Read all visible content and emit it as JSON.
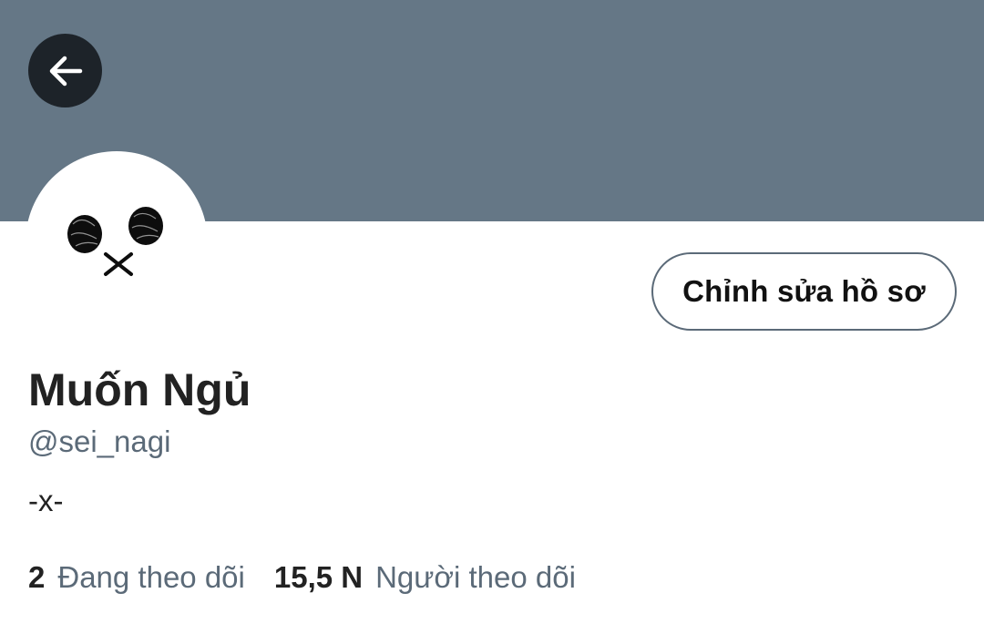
{
  "colors": {
    "banner": "#657786",
    "back_button_bg": "#1d2329",
    "secondary_text": "#5b6a78",
    "primary_text": "#222222"
  },
  "header": {
    "back_icon": "arrow-left-icon"
  },
  "profile": {
    "edit_button_label": "Chỉnh sửa hồ sơ",
    "display_name": "Muốn Ngủ",
    "handle": "@sei_nagi",
    "bio": "-x-",
    "following_count": "2",
    "following_label": "Đang theo dõi",
    "followers_count": "15,5 N",
    "followers_label": "Người theo dõi"
  }
}
